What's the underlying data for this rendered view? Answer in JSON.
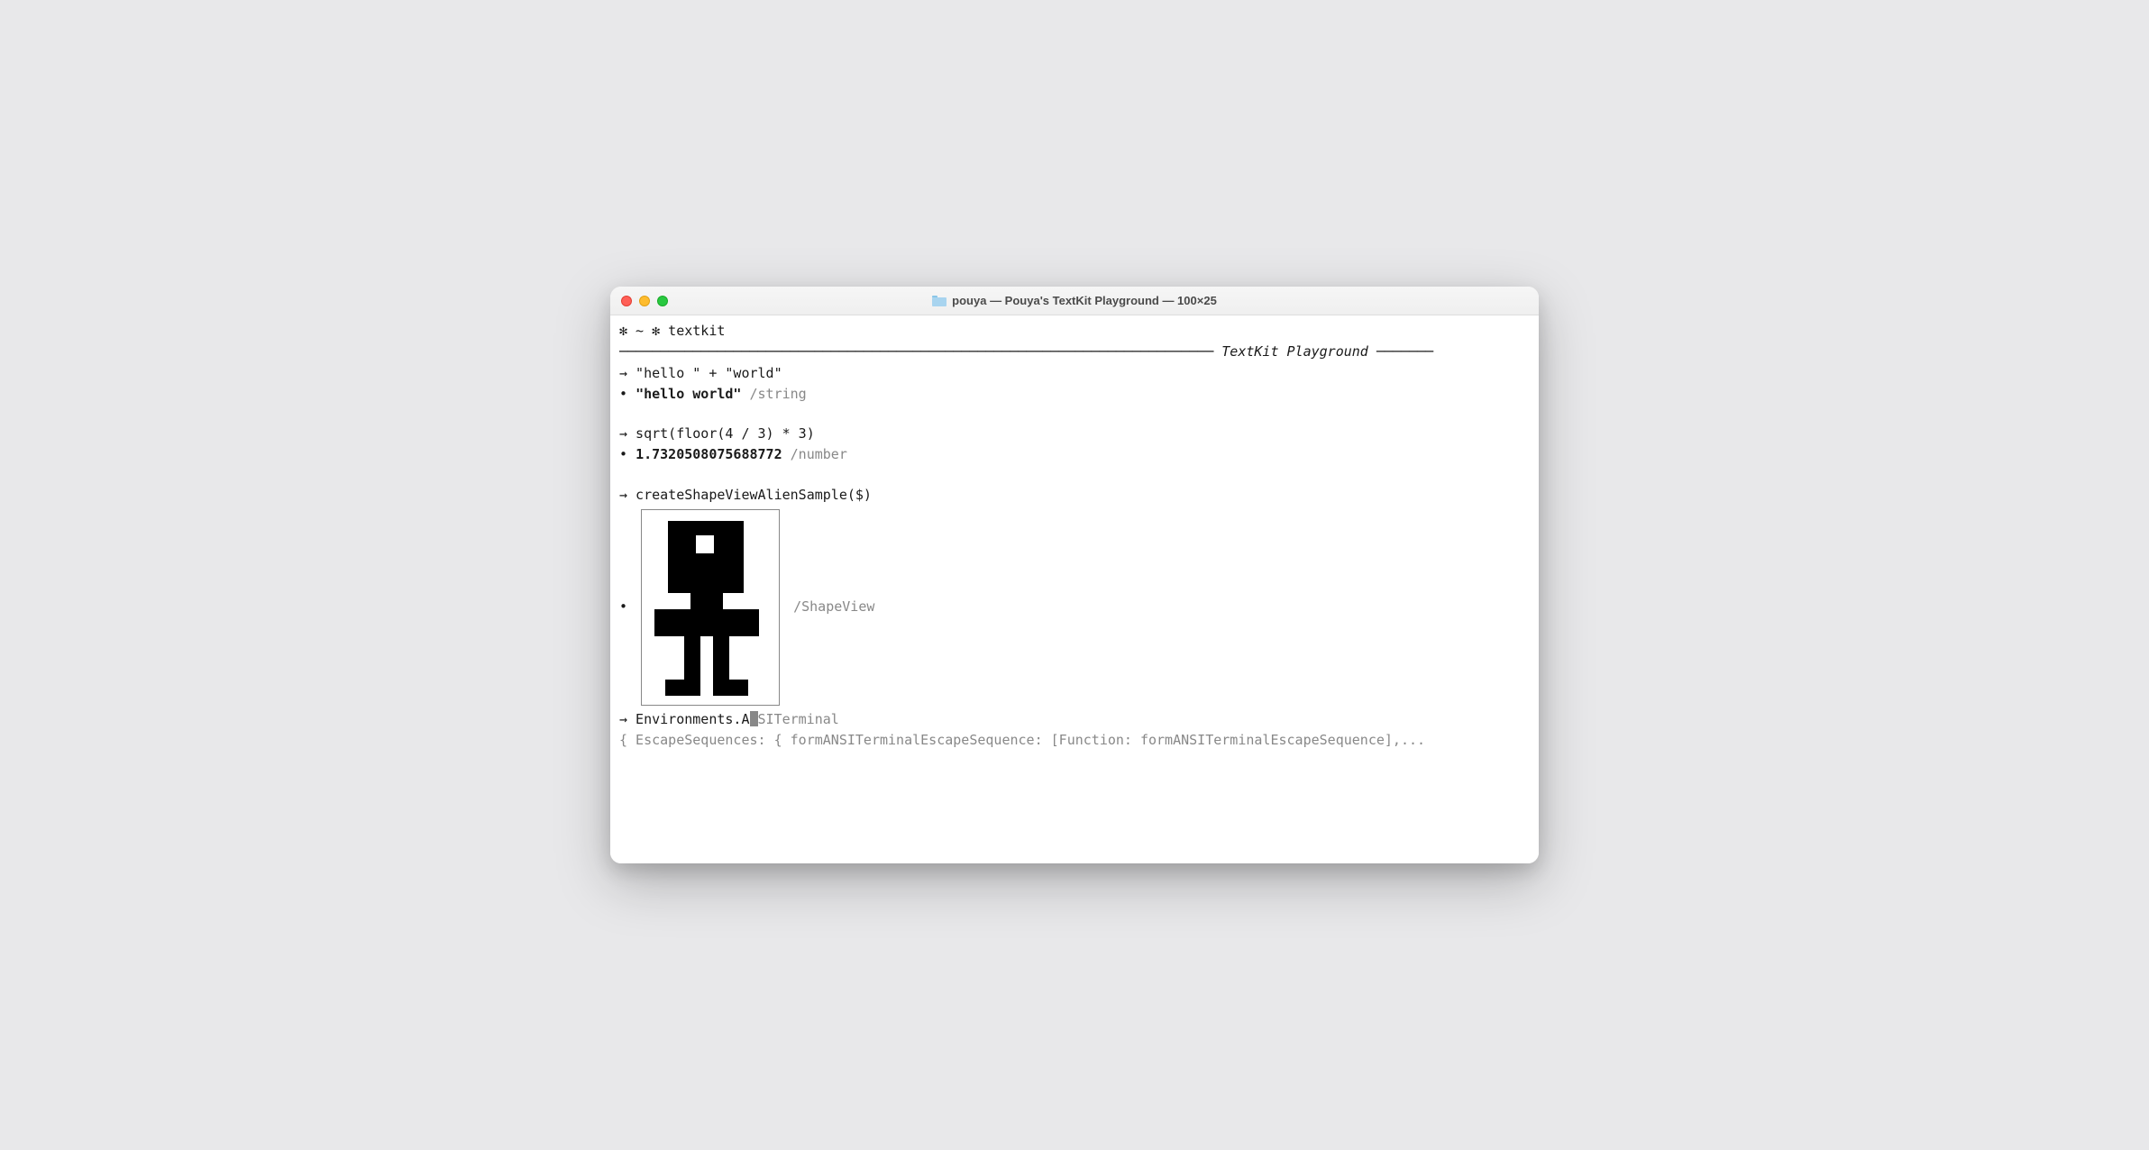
{
  "window": {
    "title": "pouya — Pouya's TextKit Playground — 100×25"
  },
  "header": {
    "prompt": "✻ ~ ✻ textkit",
    "banner_label": "TextKit Playground"
  },
  "lines": {
    "l1_in": "→ \"hello \" + \"world\"",
    "l1_out_bullet": "• ",
    "l1_out_bold": "\"hello world\"",
    "l1_out_type": " /string",
    "l2_in": "→ sqrt(floor(4 / 3) * 3)",
    "l2_out_bullet": "• ",
    "l2_out_bold": "1.7320508075688772",
    "l2_out_type": " /number",
    "l3_in": "→ createShapeViewAlienSample($)",
    "l3_out_bullet": "• ",
    "l3_out_type": " /ShapeView",
    "l4_prompt": "→ Environments.A",
    "l4_autofill": "SITerminal",
    "l4_preview": "{ EscapeSequences: { formANSITerminalEscapeSequence: [Function: formANSITerminalEscapeSequence],..."
  }
}
